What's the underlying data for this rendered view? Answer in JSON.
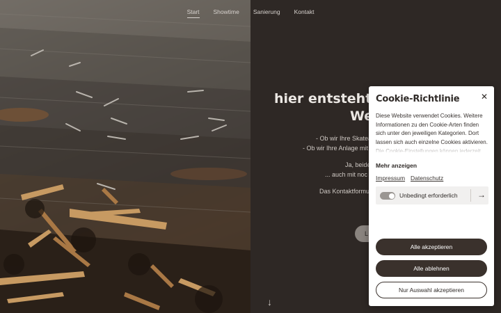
{
  "nav": {
    "items": [
      "Start",
      "Showtime",
      "Sanierung",
      "Kontakt"
    ],
    "active": "Start"
  },
  "hero": {
    "title_line1": "hier entsteht ne",
    "title_line2": "We",
    "line1": "- Ob wir Ihre Skatea",
    "line2": "- Ob wir Ihre Anlage mit",
    "line3": "Ja, beide",
    "line4": "... auch mit noc",
    "line5": "Das Kontaktformu",
    "button_label": "L",
    "scroll_arrow": "↓"
  },
  "cookie": {
    "title": "Cookie-Richtlinie",
    "close_icon": "✕",
    "text": "Diese Website verwendet Cookies. Weitere Informationen zu den Cookie-Arten finden sich unter den jeweiligen Kategorien. Dort lassen sich auch einzelne Cookies aktivieren. Die Cookie-Einstellungen können jederzeit",
    "more_label": "Mehr anzeigen",
    "links": [
      "Impressum",
      "Datenschutz"
    ],
    "category_label": "Unbedingt erforderlich",
    "category_arrow": "→",
    "accept_all": "Alle akzeptieren",
    "reject_all": "Alle ablehnen",
    "accept_selection": "Nur Auswahl akzeptieren"
  },
  "colors": {
    "panel": "#2e2825",
    "button_dark": "#3a312c",
    "toggle": "#9a9692"
  }
}
